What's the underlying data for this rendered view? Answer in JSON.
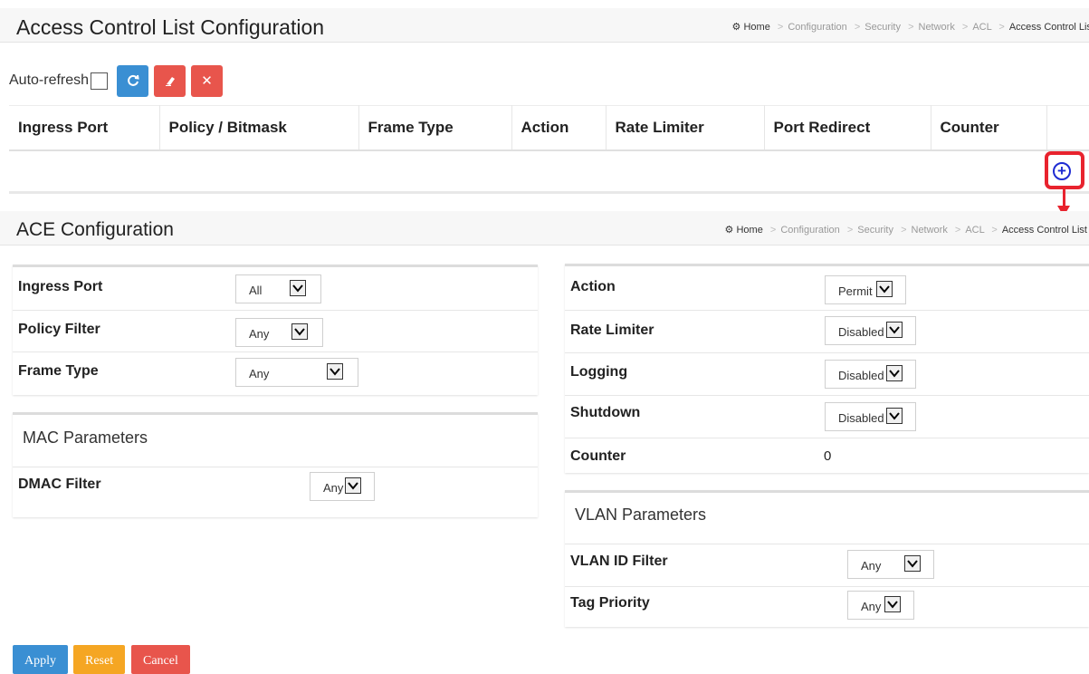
{
  "acl_page": {
    "title": "Access Control List Configuration",
    "breadcrumb": [
      "Home",
      "Configuration",
      "Security",
      "Network",
      "ACL",
      "Access Control List"
    ]
  },
  "toolbar": {
    "auto_refresh_label": "Auto-refresh",
    "refresh_icon": "refresh-icon",
    "clear_icon": "eraser-icon",
    "remove_icon": "close-icon"
  },
  "acl_table": {
    "columns": [
      "Ingress Port",
      "Policy / Bitmask",
      "Frame Type",
      "Action",
      "Rate Limiter",
      "Port Redirect",
      "Counter"
    ],
    "add_icon": "plus-circle-icon"
  },
  "ace_page": {
    "title": "ACE Configuration",
    "breadcrumb": [
      "Home",
      "Configuration",
      "Security",
      "Network",
      "ACL",
      "Access Control List"
    ]
  },
  "left_panel": {
    "ingress_port": {
      "label": "Ingress Port",
      "value": "All"
    },
    "policy_filter": {
      "label": "Policy Filter",
      "value": "Any"
    },
    "frame_type": {
      "label": "Frame Type",
      "value": "Any"
    }
  },
  "mac_params": {
    "title": "MAC Parameters",
    "dmac_filter": {
      "label": "DMAC Filter",
      "value": "Any"
    }
  },
  "right_panel": {
    "action": {
      "label": "Action",
      "value": "Permit"
    },
    "rate_limiter": {
      "label": "Rate Limiter",
      "value": "Disabled"
    },
    "logging": {
      "label": "Logging",
      "value": "Disabled"
    },
    "shutdown": {
      "label": "Shutdown",
      "value": "Disabled"
    },
    "counter": {
      "label": "Counter",
      "value": "0"
    }
  },
  "vlan_params": {
    "title": "VLAN Parameters",
    "vlan_id_filter": {
      "label": "VLAN ID Filter",
      "value": "Any"
    },
    "tag_priority": {
      "label": "Tag Priority",
      "value": "Any"
    }
  },
  "buttons": {
    "apply": "Apply",
    "reset": "Reset",
    "cancel": "Cancel"
  },
  "colors": {
    "primary": "#3a8fd3",
    "warning": "#f5a623",
    "danger": "#e8554c",
    "highlight": "#e8232e"
  }
}
